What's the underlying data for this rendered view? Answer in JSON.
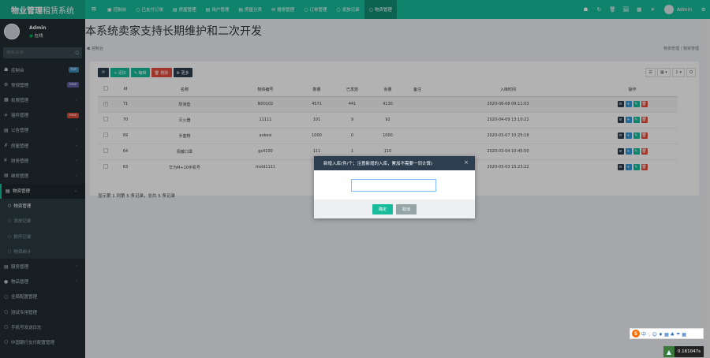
{
  "topbar": {
    "logo_bold": "物业管理",
    "logo_rest": "租赁系统",
    "tabs": [
      {
        "icon": "▣",
        "label": "控制台"
      },
      {
        "icon": "○",
        "label": "已支付订单"
      },
      {
        "icon": "▤",
        "label": "房屋管理"
      },
      {
        "icon": "▤",
        "label": "用户管理"
      },
      {
        "icon": "▤",
        "label": "房屋分类"
      },
      {
        "icon": "✉",
        "label": "报修管理"
      },
      {
        "icon": "○",
        "label": "订单管理"
      },
      {
        "icon": "○",
        "label": "发放记录"
      },
      {
        "icon": "○",
        "label": "物资管理"
      }
    ],
    "right_icons": [
      "☗",
      "↻",
      "🗑",
      "🖼",
      "▦",
      "✕"
    ],
    "user_name": "Admin",
    "settings_icon": "⚙"
  },
  "sidebar": {
    "user_name": "Admin",
    "status_dot": "●",
    "status_label": "在线",
    "search_placeholder": "搜索菜单",
    "search_icon": "Q",
    "items": [
      {
        "icon": "☗",
        "label": "控制台",
        "badge": "hot",
        "badge_color": "#3c8dbc"
      },
      {
        "icon": "⚙",
        "label": "常规管理",
        "badge": "new",
        "badge_color": "#605ca8"
      },
      {
        "icon": "▦",
        "label": "权限管理",
        "caret": "‹"
      },
      {
        "icon": "✈",
        "label": "插件管理",
        "badge": "new",
        "badge_color": "#dd4b39"
      },
      {
        "icon": "▤",
        "label": "公告管理",
        "caret": "‹"
      },
      {
        "icon": "✗",
        "label": "房屋管理",
        "caret": "‹"
      },
      {
        "icon": "¥",
        "label": "财务管理",
        "caret": "‹"
      },
      {
        "icon": "▤",
        "label": "维修管理",
        "caret": "‹"
      }
    ],
    "open_item": {
      "icon": "▤",
      "label": "物资管理",
      "caret": "⌄"
    },
    "sub_items": [
      {
        "label": "物资管理"
      },
      {
        "label": "发放记录"
      },
      {
        "label": "损坏记录"
      },
      {
        "label": "物资统计"
      }
    ],
    "items_after": [
      {
        "icon": "▤",
        "label": "服务管理",
        "caret": "‹"
      },
      {
        "icon": "●",
        "label": "物品管理",
        "caret": "‹"
      }
    ],
    "plain_items": [
      {
        "label": "全局配置管理"
      },
      {
        "label": "测试专用管理"
      },
      {
        "label": "手机号发送日志"
      },
      {
        "label": "中国银行支付配置管理"
      }
    ]
  },
  "content": {
    "title": "本系统卖家支持长期维护和二次开发",
    "dashboard_link": "控制台",
    "breadcrumb": "物资管理 / 物资管理"
  },
  "toolbar": {
    "refresh_icon": "⟳",
    "add_label": "+ 添加",
    "edit_label": "✎ 编辑",
    "delete_label": "🗑 删除",
    "more_label": "⚙ 更多",
    "right_tools": [
      "☰",
      "▦ ▾",
      "⇩ ▾",
      "Q"
    ]
  },
  "table": {
    "headers": [
      "",
      "Id",
      "名称",
      "物资编号",
      "数量",
      "已发放",
      "余量",
      "备注",
      "入库时间",
      "操作"
    ],
    "rows": [
      {
        "checked": true,
        "id": "71",
        "name": "防滑垫",
        "code": "N00102",
        "qty": "4571",
        "issued": "441",
        "remain": "4130",
        "note": "",
        "time": "2020-06-08 09:11:03"
      },
      {
        "checked": false,
        "id": "70",
        "name": "灭火器",
        "code": "11111",
        "qty": "101",
        "issued": "9",
        "remain": "92",
        "note": "",
        "time": "2020-04-09 13:10:22"
      },
      {
        "checked": false,
        "id": "69",
        "name": "手套鞋",
        "code": "aokesi",
        "qty": "1000",
        "issued": "0",
        "remain": "1000",
        "note": "",
        "time": "2020-03-07 10:25:18"
      },
      {
        "checked": false,
        "id": "64",
        "name": "佩戴口罩",
        "code": "gs4100",
        "qty": "111",
        "issued": "1",
        "remain": "110",
        "note": "",
        "time": "2020-03-04 10:45:50"
      },
      {
        "checked": false,
        "id": "63",
        "name": "华为M+10手机号",
        "code": "mold1111",
        "qty": "",
        "issued": "",
        "remain": "",
        "note": "",
        "time": "2020-03-03 15:23:22"
      }
    ],
    "op_icons": [
      "≡",
      "+",
      "✎",
      "🗑"
    ],
    "page_info": "显示第 1 到第 5 条记录，总共 5 条记录"
  },
  "dialog": {
    "title": "新增入库(件/个；注意新增的入库，累加不需要一同计算)",
    "close_icon": "×",
    "input_value": "",
    "ok_label": "确定",
    "cancel_label": "取消"
  },
  "ime": {
    "logo": "S",
    "text": "中 ·, ☺ ♦ ▦ ♣ ☂ ▦"
  },
  "footer_widget": {
    "icon": "▲",
    "value": "0.161047s"
  }
}
